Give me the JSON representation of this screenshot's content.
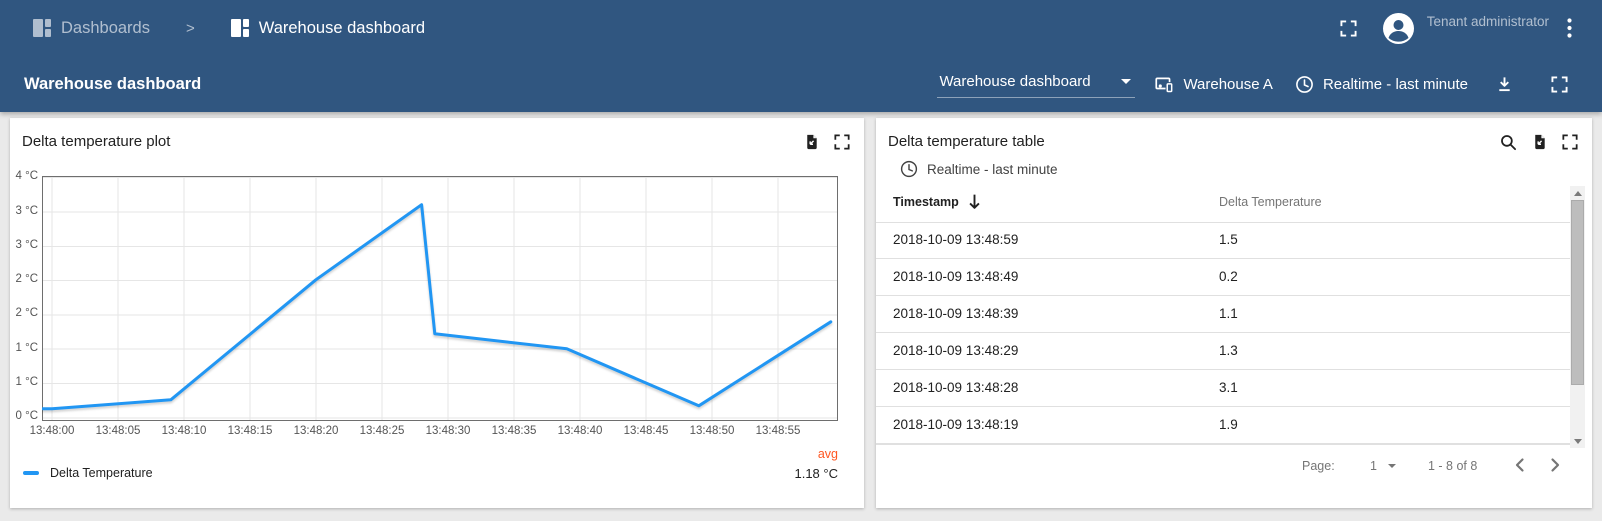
{
  "colors": {
    "app_bar": "#305680",
    "series_blue": "#2196f3",
    "avg_orange": "#ff5722",
    "page_bg": "#eaeaea"
  },
  "top_nav": {
    "breadcrumb": [
      {
        "label": "Dashboards"
      },
      {
        "label": "Warehouse dashboard"
      }
    ],
    "separator": ">",
    "user_role": "Tenant administrator"
  },
  "dashboard_toolbar": {
    "title": "Warehouse dashboard",
    "state_select": {
      "value": "Warehouse dashboard"
    },
    "entity": "Warehouse A",
    "timewindow": "Realtime - last minute"
  },
  "plot_widget": {
    "title": "Delta temperature plot",
    "legend": {
      "series_label": "Delta Temperature",
      "agg_label": "avg",
      "agg_value": "1.18 °C"
    }
  },
  "chart_data": {
    "type": "line",
    "title": "Delta temperature plot",
    "x_window": [
      "13:47:59",
      "13:48:59"
    ],
    "ylim": [
      0,
      4
    ],
    "grid": true,
    "legend_position": "bottom-left",
    "x_ticks": [
      "13:48:00",
      "13:48:05",
      "13:48:10",
      "13:48:15",
      "13:48:20",
      "13:48:25",
      "13:48:30",
      "13:48:35",
      "13:48:40",
      "13:48:45",
      "13:48:50",
      "13:48:55"
    ],
    "y_ticks": [
      "4 °C",
      "3 °C",
      "3 °C",
      "2 °C",
      "2 °C",
      "1 °C",
      "1 °C",
      "0 °C"
    ],
    "series": [
      {
        "name": "Delta Temperature",
        "color": "#2196f3",
        "points": [
          [
            "13:48:00",
            0.15
          ],
          [
            "13:48:09",
            0.3
          ],
          [
            "13:48:20",
            2.3
          ],
          [
            "13:48:28",
            3.55
          ],
          [
            "13:48:29",
            1.4
          ],
          [
            "13:48:39",
            1.15
          ],
          [
            "13:48:49",
            0.2
          ],
          [
            "13:48:59",
            1.6
          ]
        ]
      }
    ],
    "aggregation": {
      "label": "avg",
      "value": "1.18 °C"
    }
  },
  "table_widget": {
    "title": "Delta temperature table",
    "timewindow": "Realtime - last minute",
    "columns": [
      "Timestamp",
      "Delta Temperature"
    ],
    "sort": {
      "column": "Timestamp",
      "direction": "desc"
    },
    "rows": [
      {
        "timestamp": "2018-10-09 13:48:59",
        "value": "1.5"
      },
      {
        "timestamp": "2018-10-09 13:48:49",
        "value": "0.2"
      },
      {
        "timestamp": "2018-10-09 13:48:39",
        "value": "1.1"
      },
      {
        "timestamp": "2018-10-09 13:48:29",
        "value": "1.3"
      },
      {
        "timestamp": "2018-10-09 13:48:28",
        "value": "3.1"
      },
      {
        "timestamp": "2018-10-09 13:48:19",
        "value": "1.9"
      }
    ],
    "pagination": {
      "page_label": "Page:",
      "page": "1",
      "range": "1 - 8 of 8"
    }
  }
}
